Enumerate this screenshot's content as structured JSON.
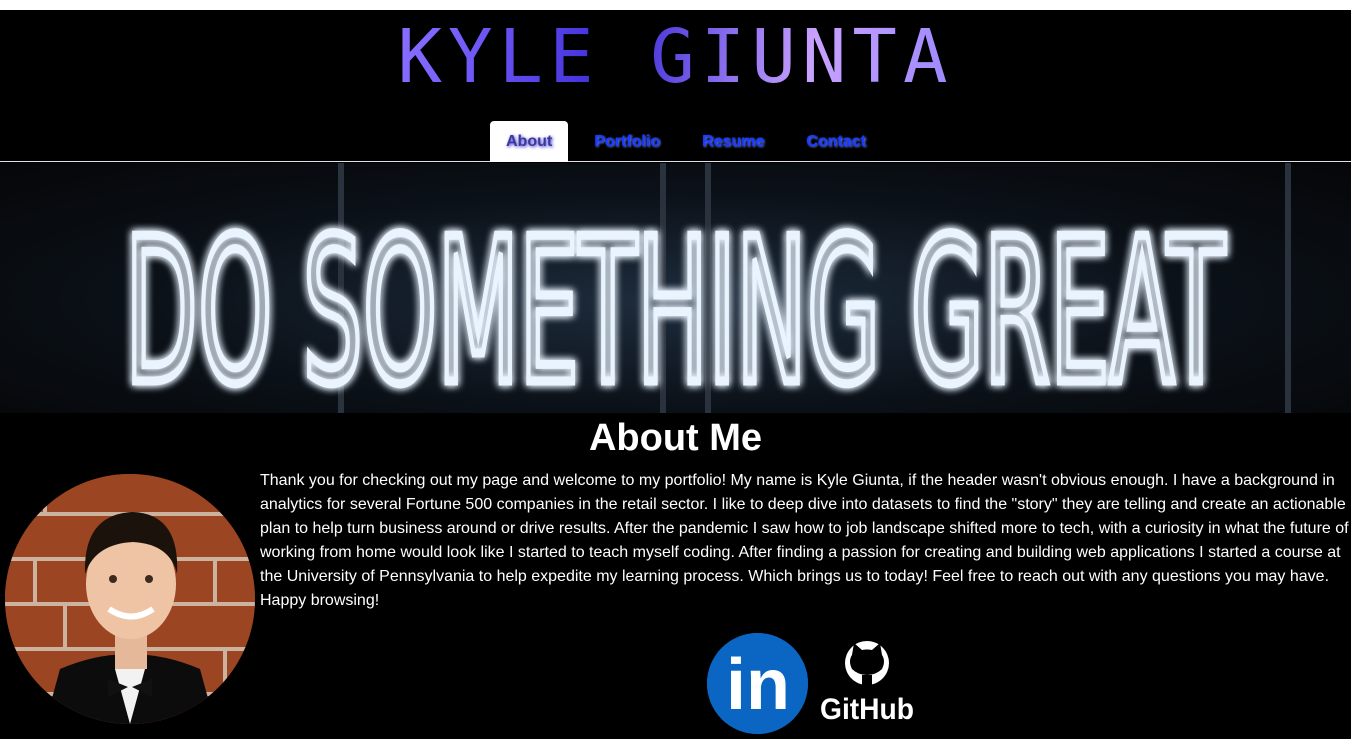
{
  "header": {
    "title": "KYLE GIUNTA"
  },
  "nav": {
    "tabs": [
      {
        "label": "About"
      },
      {
        "label": "Portfolio"
      },
      {
        "label": "Resume"
      },
      {
        "label": "Contact"
      }
    ]
  },
  "hero": {
    "sign_text": "DO SOMETHING GREAT"
  },
  "about": {
    "heading": "About Me",
    "bio": "Thank you for checking out my page and welcome to my portfolio! My name is Kyle Giunta, if the header wasn't obvious enough. I have a background in analytics for several Fortune 500 companies in the retail sector. I like to deep dive into datasets to find the \"story\" they are telling and create an actionable plan to help turn business around or drive results. After the pandemic I saw how to job landscape shifted more to tech, with a curiosity in what the future of working from home would look like I started to teach myself coding. After finding a passion for creating and building web applications I started a course at the University of Pennsylvania to help expedite my learning process. Which brings us to today! Feel free to reach out with any questions you may have. Happy browsing!"
  },
  "social": {
    "linkedin_label": "in",
    "github_label": "GitHub"
  },
  "colors": {
    "background": "#000000",
    "nav_link": "#1a3dff",
    "linkedin": "#0a66c2"
  },
  "icons": {
    "linkedin": "linkedin-icon",
    "github": "github-icon"
  }
}
